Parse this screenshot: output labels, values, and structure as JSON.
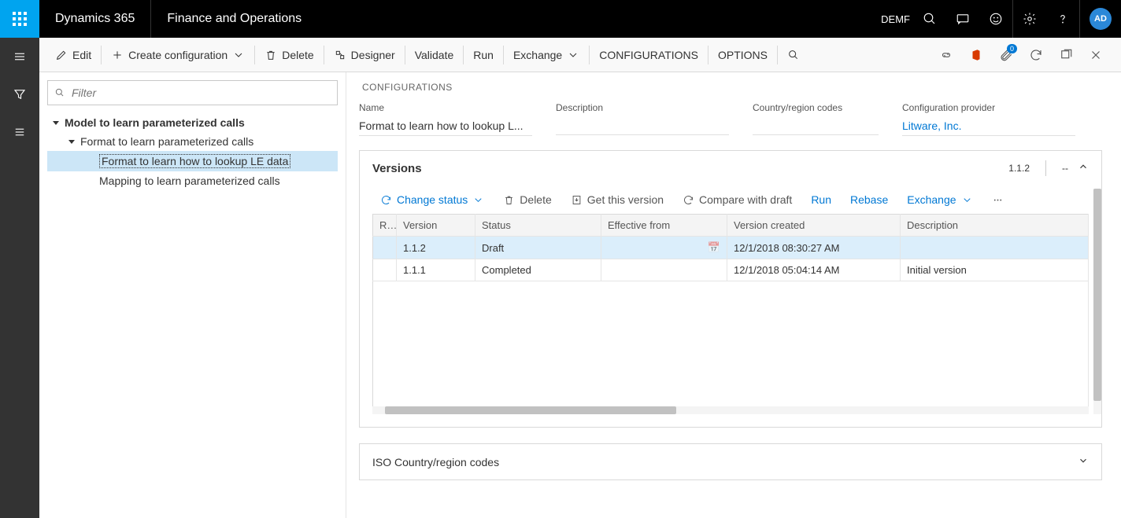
{
  "topbar": {
    "brand": "Dynamics 365",
    "subbrand": "Finance and Operations",
    "company": "DEMF",
    "avatar": "AD"
  },
  "actionbar": {
    "edit": "Edit",
    "create": "Create configuration",
    "delete": "Delete",
    "designer": "Designer",
    "validate": "Validate",
    "run": "Run",
    "exchange": "Exchange",
    "configurations": "CONFIGURATIONS",
    "options": "OPTIONS",
    "badge": "0"
  },
  "filter": {
    "placeholder": "Filter"
  },
  "tree": {
    "root": "Model to learn parameterized calls",
    "child1": "Format to learn parameterized calls",
    "leaf1": "Format to learn how to lookup LE data",
    "leaf2": "Mapping to learn parameterized calls"
  },
  "detail": {
    "section": "CONFIGURATIONS",
    "fields": {
      "name_label": "Name",
      "name_value": "Format to learn how to lookup L...",
      "desc_label": "Description",
      "desc_value": "",
      "country_label": "Country/region codes",
      "country_value": "",
      "provider_label": "Configuration provider",
      "provider_value": "Litware, Inc."
    }
  },
  "versions": {
    "title": "Versions",
    "current": "1.1.2",
    "dash": "--",
    "toolbar": {
      "change": "Change status",
      "delete": "Delete",
      "get": "Get this version",
      "compare": "Compare with draft",
      "run": "Run",
      "rebase": "Rebase",
      "exchange": "Exchange"
    },
    "columns": {
      "sel": "R...",
      "version": "Version",
      "status": "Status",
      "effective": "Effective from",
      "created": "Version created",
      "description": "Description"
    },
    "rows": [
      {
        "version": "1.1.2",
        "status": "Draft",
        "effective": "",
        "created": "12/1/2018 08:30:27 AM",
        "description": ""
      },
      {
        "version": "1.1.1",
        "status": "Completed",
        "effective": "",
        "created": "12/1/2018 05:04:14 AM",
        "description": "Initial version"
      }
    ]
  },
  "iso": {
    "title": "ISO Country/region codes"
  }
}
